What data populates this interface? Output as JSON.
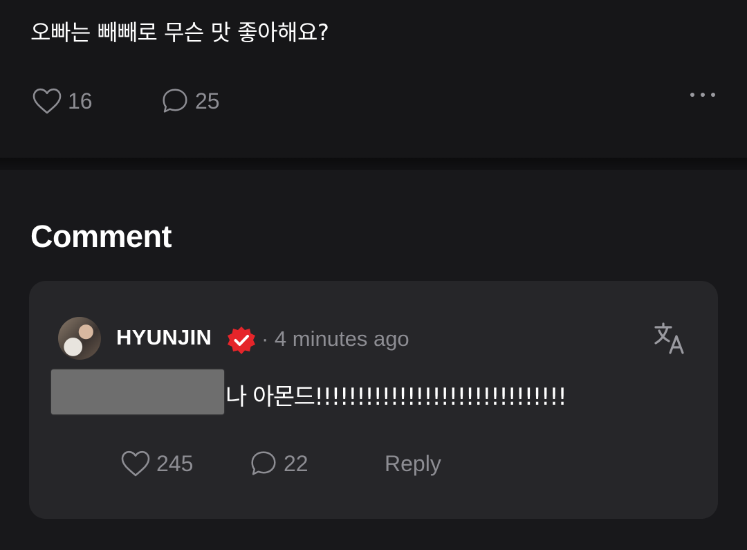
{
  "post": {
    "text": "오빠는 빼빼로 무슨 맛 좋아해요?",
    "like_count": "16",
    "comment_count": "25"
  },
  "section": {
    "heading": "Comment"
  },
  "comment": {
    "username": "HYUNJIN",
    "timestamp": "· 4 minutes ago",
    "text": "나 아몬드!!!!!!!!!!!!!!!!!!!!!!!!!!!!!!",
    "like_count": "245",
    "reply_count": "22",
    "reply_label": "Reply"
  },
  "colors": {
    "background": "#18181b",
    "card": "#262629",
    "muted_text": "#8d8d93",
    "verified_badge": "#e5252a"
  },
  "icons": {
    "like": "heart-outline-icon",
    "comment": "speech-bubble-icon",
    "more": "ellipsis-icon",
    "verified": "verified-badge-icon",
    "translate": "translate-icon"
  }
}
